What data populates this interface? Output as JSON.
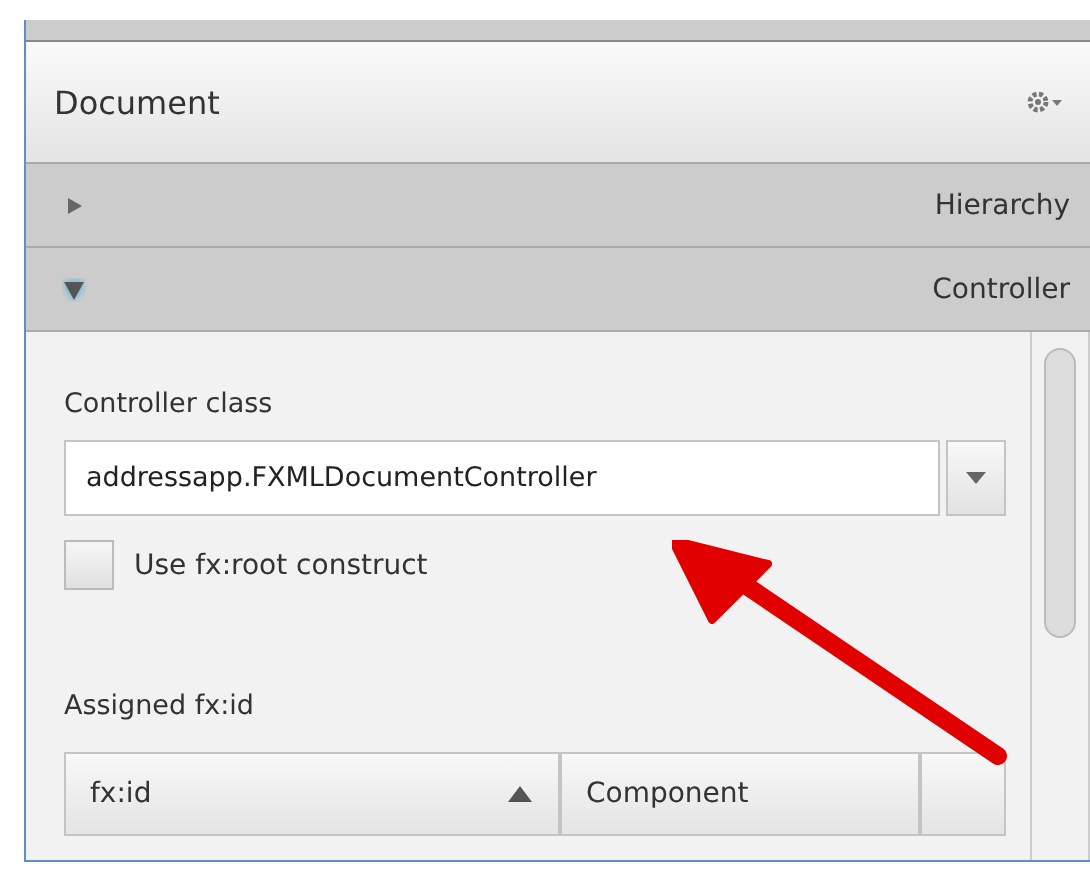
{
  "panel": {
    "title": "Document"
  },
  "sections": [
    {
      "label": "Hierarchy",
      "expanded": false
    },
    {
      "label": "Controller",
      "expanded": true
    }
  ],
  "controller": {
    "class_label": "Controller class",
    "class_value": "addressapp.FXMLDocumentController",
    "root_checkbox": {
      "label": "Use fx:root construct",
      "checked": false
    },
    "assigned_label": "Assigned fx:id"
  },
  "table": {
    "columns": [
      {
        "label": "fx:id",
        "sorted": true
      },
      {
        "label": "Component",
        "sorted": false
      }
    ]
  }
}
